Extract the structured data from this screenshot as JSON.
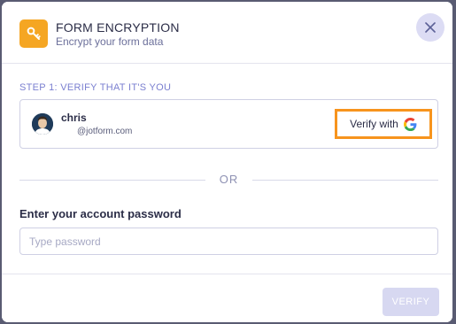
{
  "header": {
    "title": "FORM ENCRYPTION",
    "subtitle": "Encrypt your form data",
    "icon": "key-icon",
    "close_icon": "close-icon",
    "accent_color": "#f5a623"
  },
  "step1": {
    "label": "STEP 1: VERIFY THAT IT'S YOU",
    "user_name": "chris",
    "user_email": "@jotform.com",
    "verify_label": "Verify with",
    "verify_icon": "google-g-icon",
    "highlight_color": "#f7941d"
  },
  "divider": {
    "text": "OR"
  },
  "password": {
    "label": "Enter your account password",
    "placeholder": "Type password",
    "value": ""
  },
  "footer": {
    "verify_button": "VERIFY"
  }
}
